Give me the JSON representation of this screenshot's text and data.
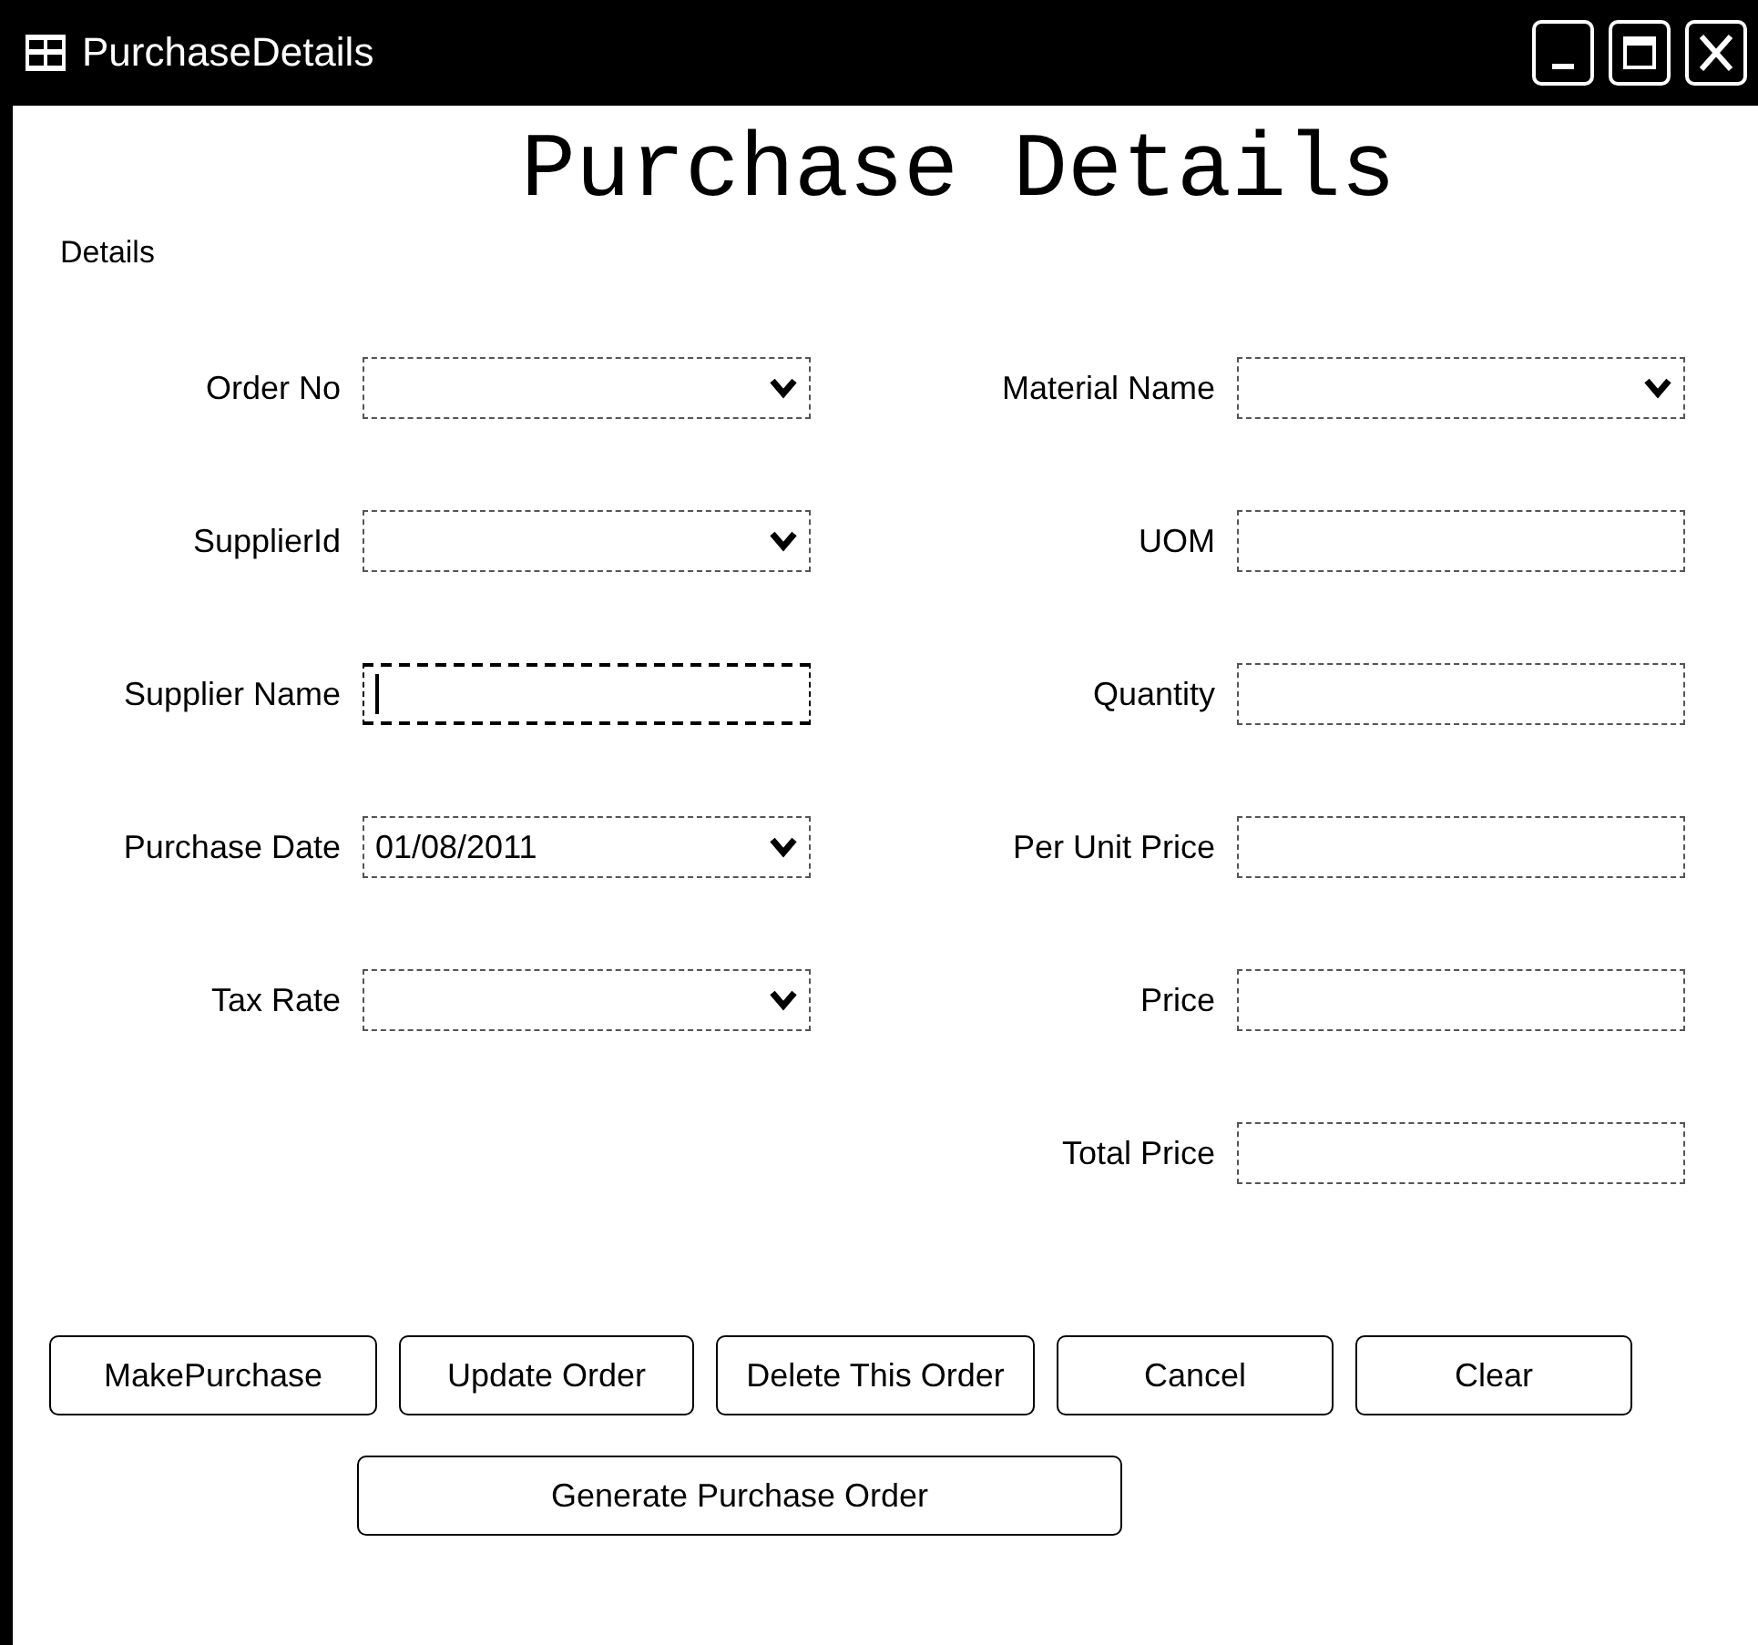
{
  "window": {
    "title": "PurchaseDetails"
  },
  "heading": "Purchase Details",
  "group_label": "Details",
  "left_fields": [
    {
      "label": "Order No",
      "kind": "combo",
      "focused": false
    },
    {
      "label": "SupplierId",
      "kind": "combo",
      "focused": false
    },
    {
      "label": "Supplier Name",
      "kind": "text",
      "focused": true
    },
    {
      "label": "Purchase Date",
      "kind": "date",
      "value": "01/08/2011",
      "focused": false
    },
    {
      "label": "Tax Rate",
      "kind": "combo",
      "focused": false
    }
  ],
  "right_fields": [
    {
      "label": "Material Name",
      "kind": "combo",
      "focused": false
    },
    {
      "label": "UOM",
      "kind": "text",
      "focused": false
    },
    {
      "label": "Quantity",
      "kind": "text",
      "focused": false
    },
    {
      "label": "Per Unit Price",
      "kind": "text",
      "focused": false
    },
    {
      "label": "Price",
      "kind": "text",
      "focused": false
    },
    {
      "label": "Total Price",
      "kind": "text",
      "focused": false
    }
  ],
  "buttons": [
    "MakePurchase",
    "Update Order",
    "Delete This Order",
    "Cancel",
    "Clear"
  ],
  "bottom_button": "Generate Purchase Order"
}
